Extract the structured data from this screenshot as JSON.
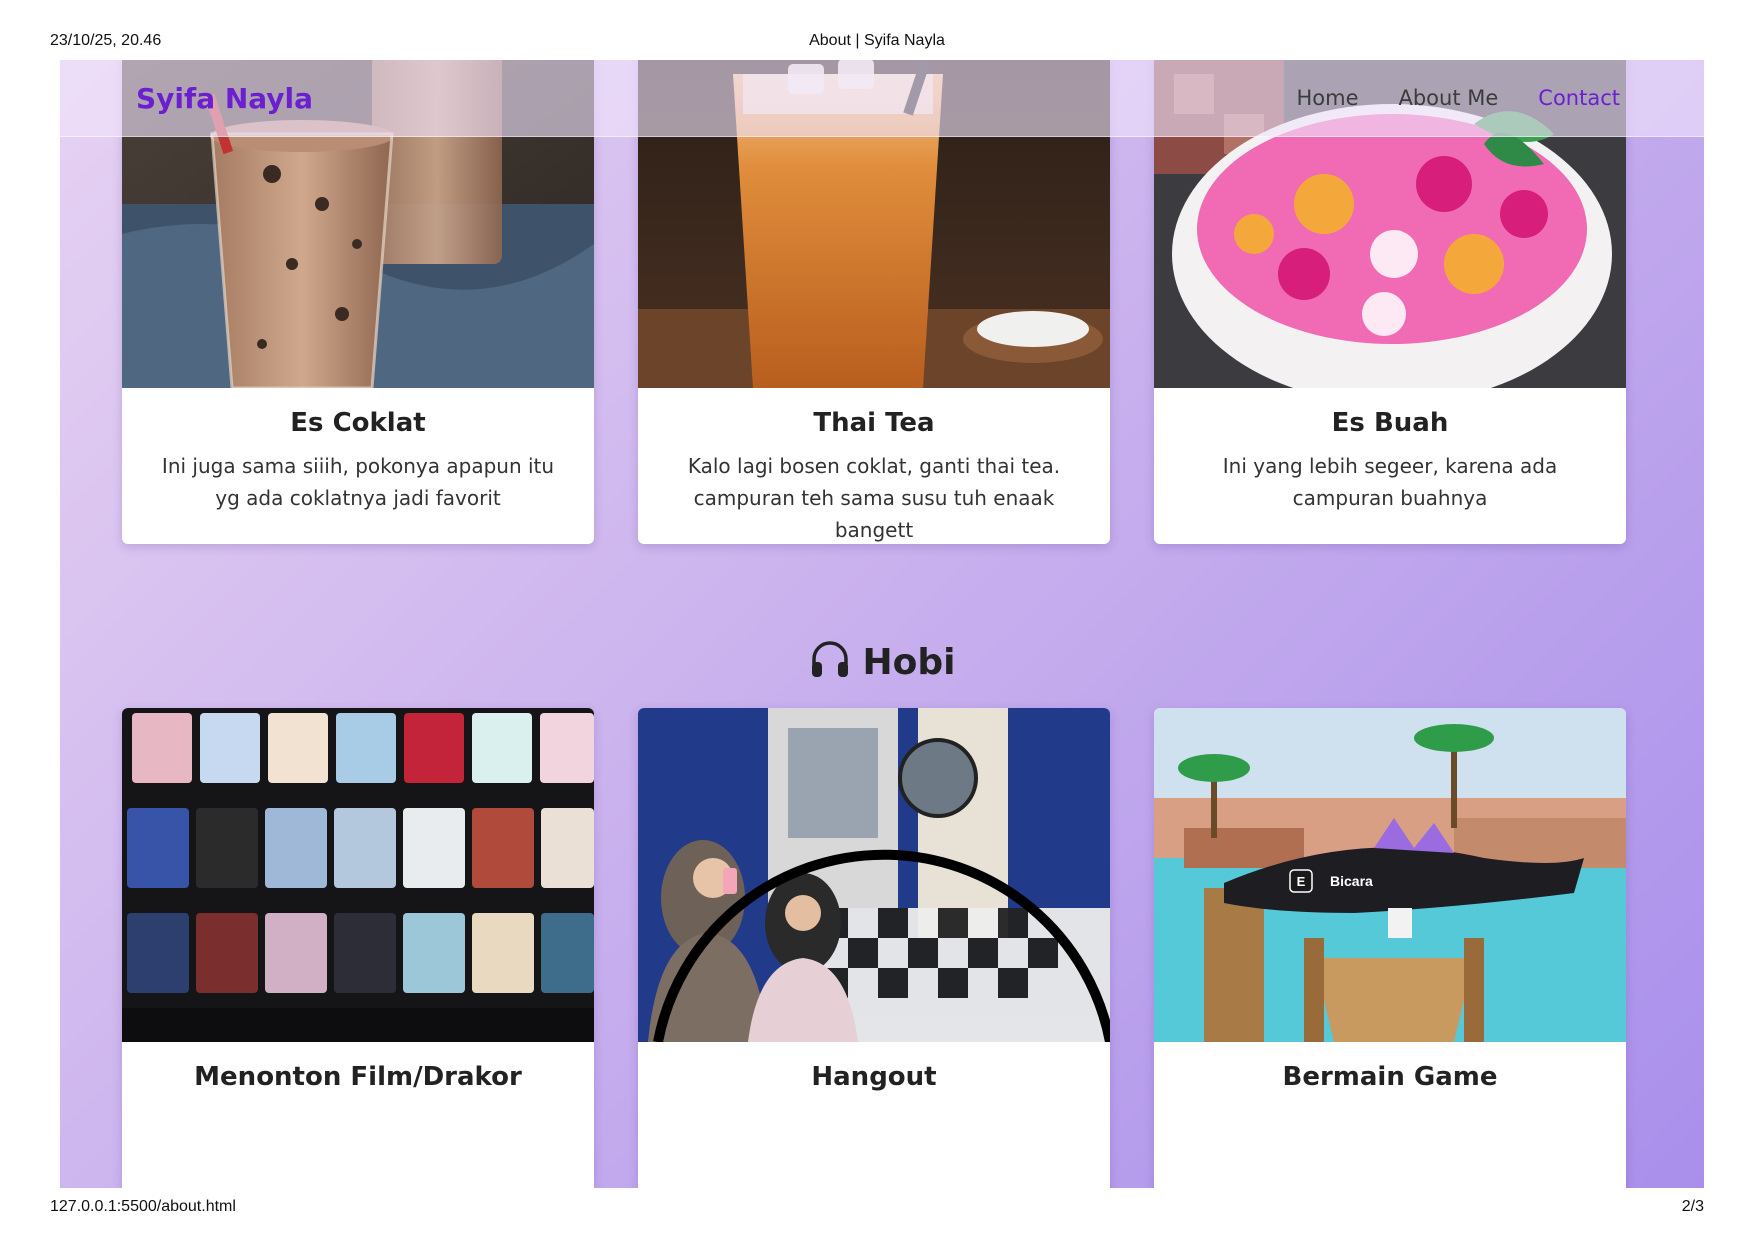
{
  "print": {
    "datetime": "23/10/25, 20.46",
    "title": "About | Syifa Nayla",
    "url": "127.0.0.1:5500/about.html",
    "page": "2/3"
  },
  "navbar": {
    "brand": "Syifa Nayla",
    "links": [
      "Home",
      "About Me",
      "Contact"
    ],
    "active": "Contact"
  },
  "favorites": [
    {
      "title": "Es Coklat",
      "text": "Ini juga sama siiih, pokonya apapun itu yg ada coklatnya jadi favorit",
      "image": "chocolate-milk-glasses"
    },
    {
      "title": "Thai Tea",
      "text": "Kalo lagi bosen coklat, ganti thai tea. campuran teh sama susu tuh enaak bangett",
      "image": "iced-thai-tea"
    },
    {
      "title": "Es Buah",
      "text": "Ini yang lebih segeer, karena ada campuran buahnya",
      "image": "fruit-ice-bowl"
    }
  ],
  "hobbies_section": {
    "title": "Hobi",
    "icon": "headphones-icon",
    "items": [
      {
        "title": "Menonton Film/Drakor",
        "image": "streaming-posters"
      },
      {
        "title": "Hangout",
        "image": "photobooth-selfie"
      },
      {
        "title": "Bermain Game",
        "image": "game-dock-scene",
        "overlay": {
          "key": "E",
          "label": "Bicara"
        }
      }
    ]
  },
  "colors": {
    "brand": "#6c1fd1",
    "gradient_start": "#e6d2f2",
    "gradient_end": "#a98feb"
  }
}
